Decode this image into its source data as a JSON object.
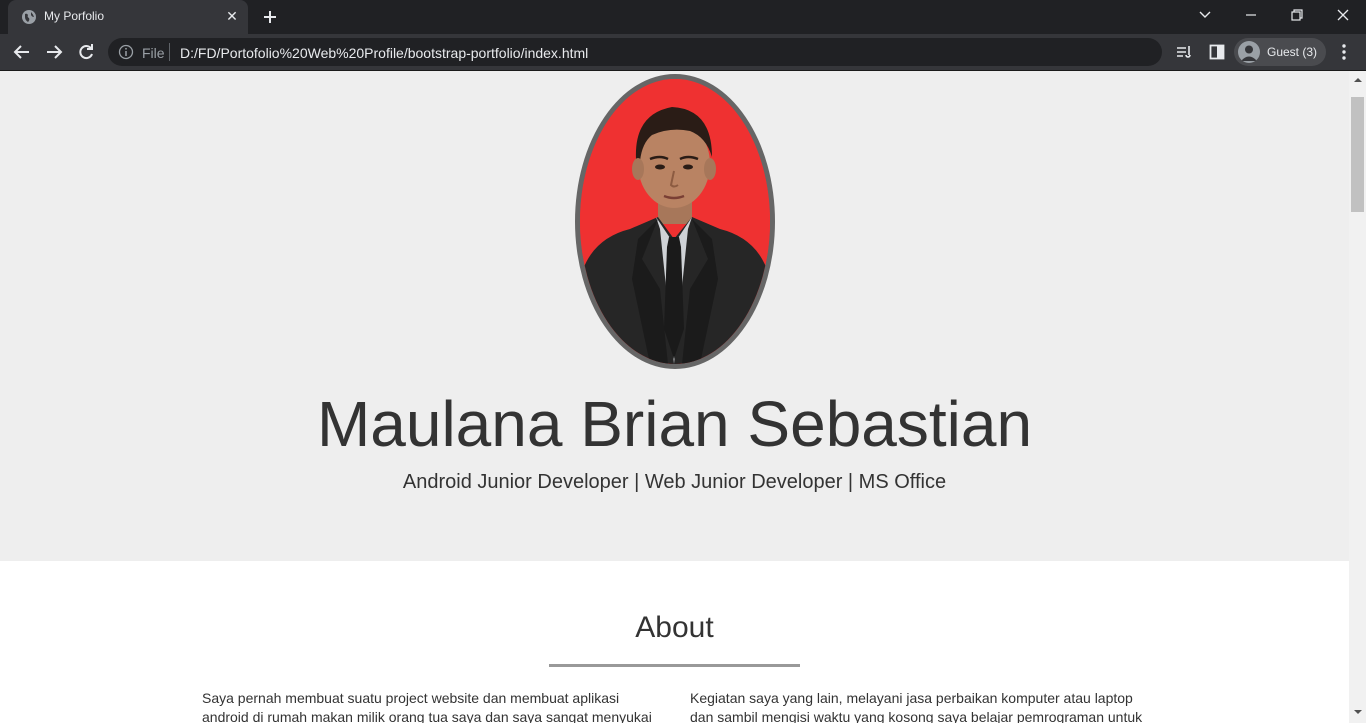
{
  "browser": {
    "tab_title": "My Porfolio",
    "address_scheme": "File",
    "address_url": "D:/FD/Portofolio%20Web%20Profile/bootstrap-portfolio/index.html",
    "profile_label": "Guest (3)"
  },
  "hero": {
    "name": "Maulana Brian Sebastian",
    "tagline": "Android Junior Developer | Web Junior Developer | MS Office"
  },
  "about": {
    "title": "About",
    "left_text": "Saya pernah membuat suatu project website dan membuat aplikasi android di rumah makan milik orang tua saya dan saya sangat menyukai",
    "right_text": "Kegiatan saya yang lain, melayani jasa perbaikan komputer atau laptop dan sambil mengisi waktu yang kosong saya belajar pemrograman untuk"
  },
  "colors": {
    "hero_bg": "#eeeeee",
    "text": "#333333",
    "photo_border": "#666666",
    "photo_bg": "#ef3131"
  },
  "icons": [
    "globe-icon",
    "close-icon",
    "plus-icon",
    "chevron-down-icon",
    "minimize-icon",
    "restore-icon",
    "window-close-icon",
    "back-arrow-icon",
    "forward-arrow-icon",
    "reload-icon",
    "info-icon",
    "reading-list-icon",
    "side-panel-icon",
    "avatar-icon",
    "kebab-menu-icon"
  ]
}
